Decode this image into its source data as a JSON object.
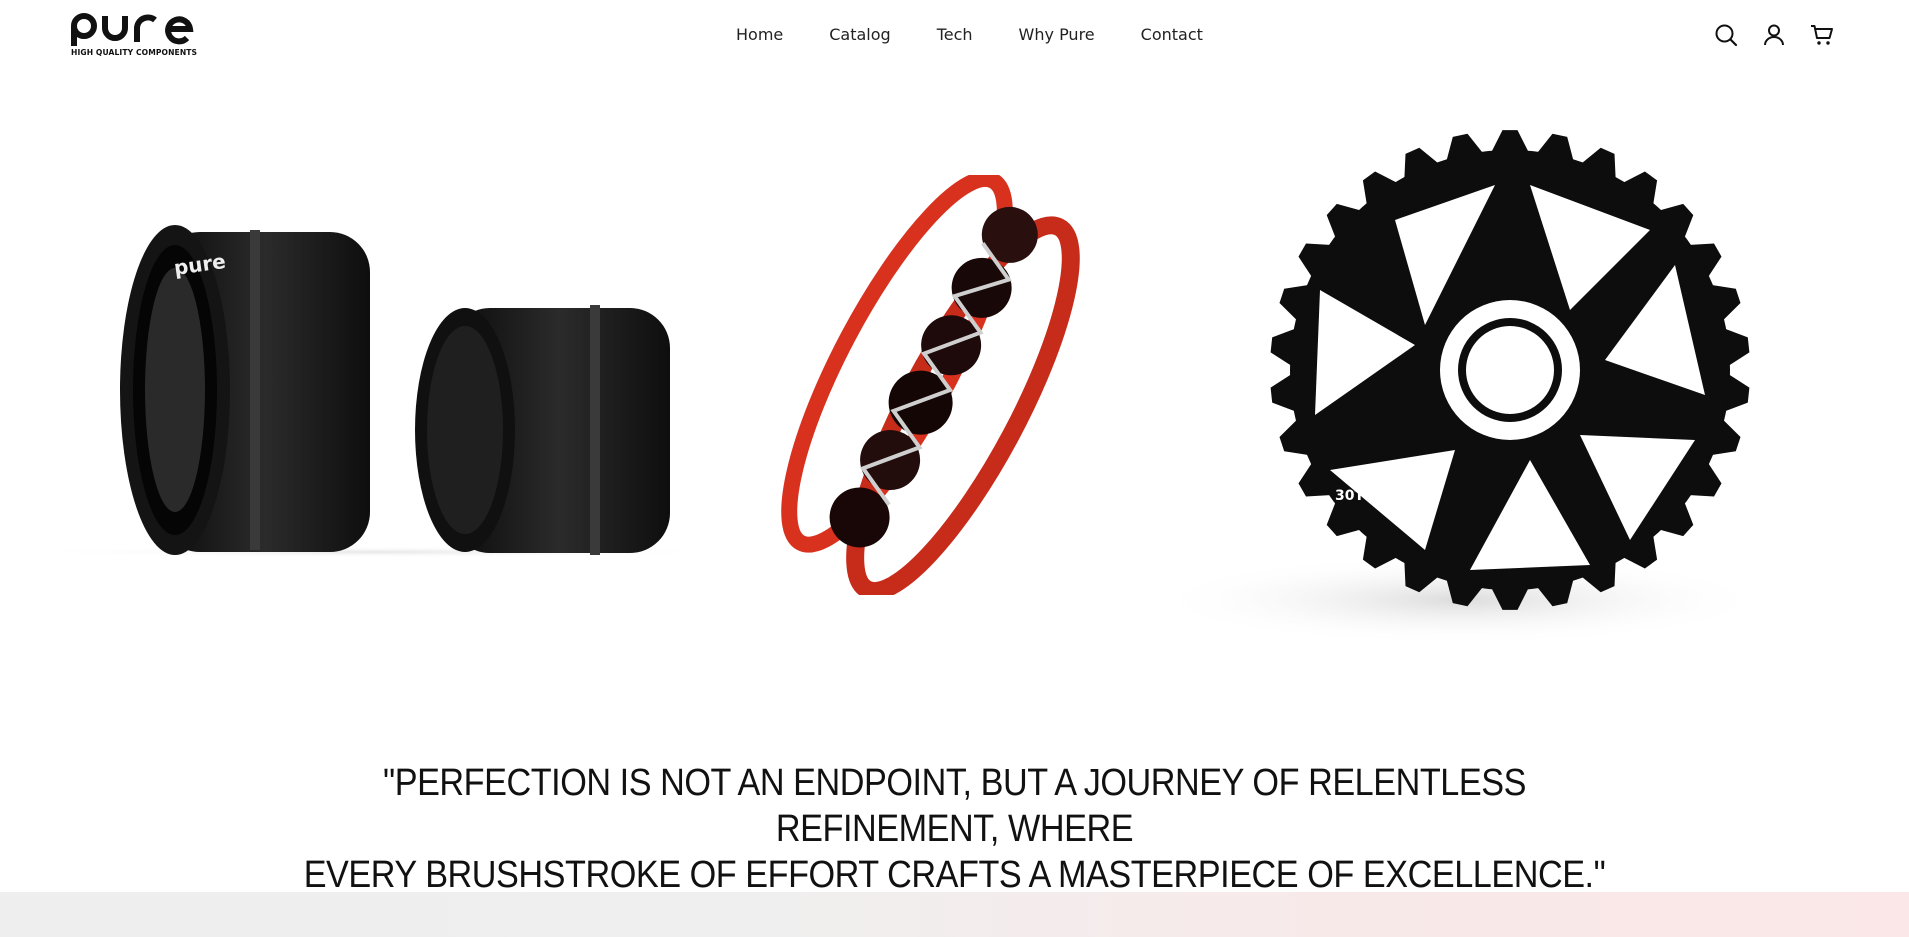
{
  "brand": {
    "logo_text": "pure",
    "tagline": "HIGH QUALITY COMPONENTS"
  },
  "nav": {
    "items": [
      {
        "label": "Home"
      },
      {
        "label": "Catalog"
      },
      {
        "label": "Tech"
      },
      {
        "label": "Why Pure"
      },
      {
        "label": "Contact"
      }
    ]
  },
  "header_icons": [
    "search-icon",
    "account-icon",
    "cart-icon"
  ],
  "hero": {
    "products": [
      {
        "name": "bottom-bracket-cups",
        "color": "#1a1a1a"
      },
      {
        "name": "red-bearing",
        "color": "#d8321f"
      },
      {
        "name": "chainring",
        "color": "#111111",
        "label": "30T"
      }
    ]
  },
  "quote": {
    "line1": "\"PERFECTION IS NOT AN ENDPOINT, BUT A JOURNEY OF RELENTLESS REFINEMENT, WHERE",
    "line2": "EVERY BRUSHSTROKE OF EFFORT CRAFTS A MASTERPIECE OF EXCELLENCE.\""
  },
  "colors": {
    "accent": "#d8321f",
    "text": "#111111",
    "band_start": "#eeeeee",
    "band_end": "#fbe7e7"
  }
}
